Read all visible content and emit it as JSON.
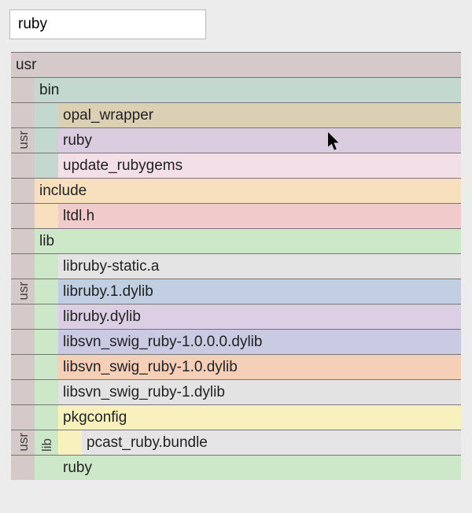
{
  "search": {
    "value": "ruby"
  },
  "tree": {
    "root": "usr",
    "side_labels": {
      "usr": "usr",
      "lib": "lib"
    },
    "bin": {
      "label": "bin",
      "items": [
        "opal_wrapper",
        "ruby",
        "update_rubygems"
      ]
    },
    "include": {
      "label": "include",
      "items": [
        "ltdl.h"
      ]
    },
    "lib": {
      "label": "lib",
      "items": [
        "libruby-static.a",
        "libruby.1.dylib",
        "libruby.dylib",
        "libsvn_swig_ruby-1.0.0.0.dylib",
        "libsvn_swig_ruby-1.0.dylib",
        "libsvn_swig_ruby-1.dylib"
      ],
      "pkgconfig": {
        "label": "pkgconfig",
        "items": [
          "pcast_ruby.bundle"
        ]
      },
      "ruby": {
        "label": "ruby"
      }
    }
  },
  "colors": {
    "usr_root": "#d6c9ca",
    "bin": "#c3d9cf",
    "opal_wrapper": "#dbd0b4",
    "ruby_bin": "#dccce0",
    "update_rubygems": "#f3dfe8",
    "include": "#f8dfbe",
    "ltdl_h": "#f1cacc",
    "lib": "#cde8c8",
    "libruby_static": "#e4e4e4",
    "libruby_1": "#c2cfe2",
    "libruby_dylib": "#dccfe5",
    "libsvn_1000": "#cacbe2",
    "libsvn_10": "#f6cfb9",
    "libsvn_1": "#e3e3e3",
    "pkgconfig": "#f8f1be",
    "pcast": "#e5e5e5",
    "ruby_folder": "#cde8c8"
  }
}
